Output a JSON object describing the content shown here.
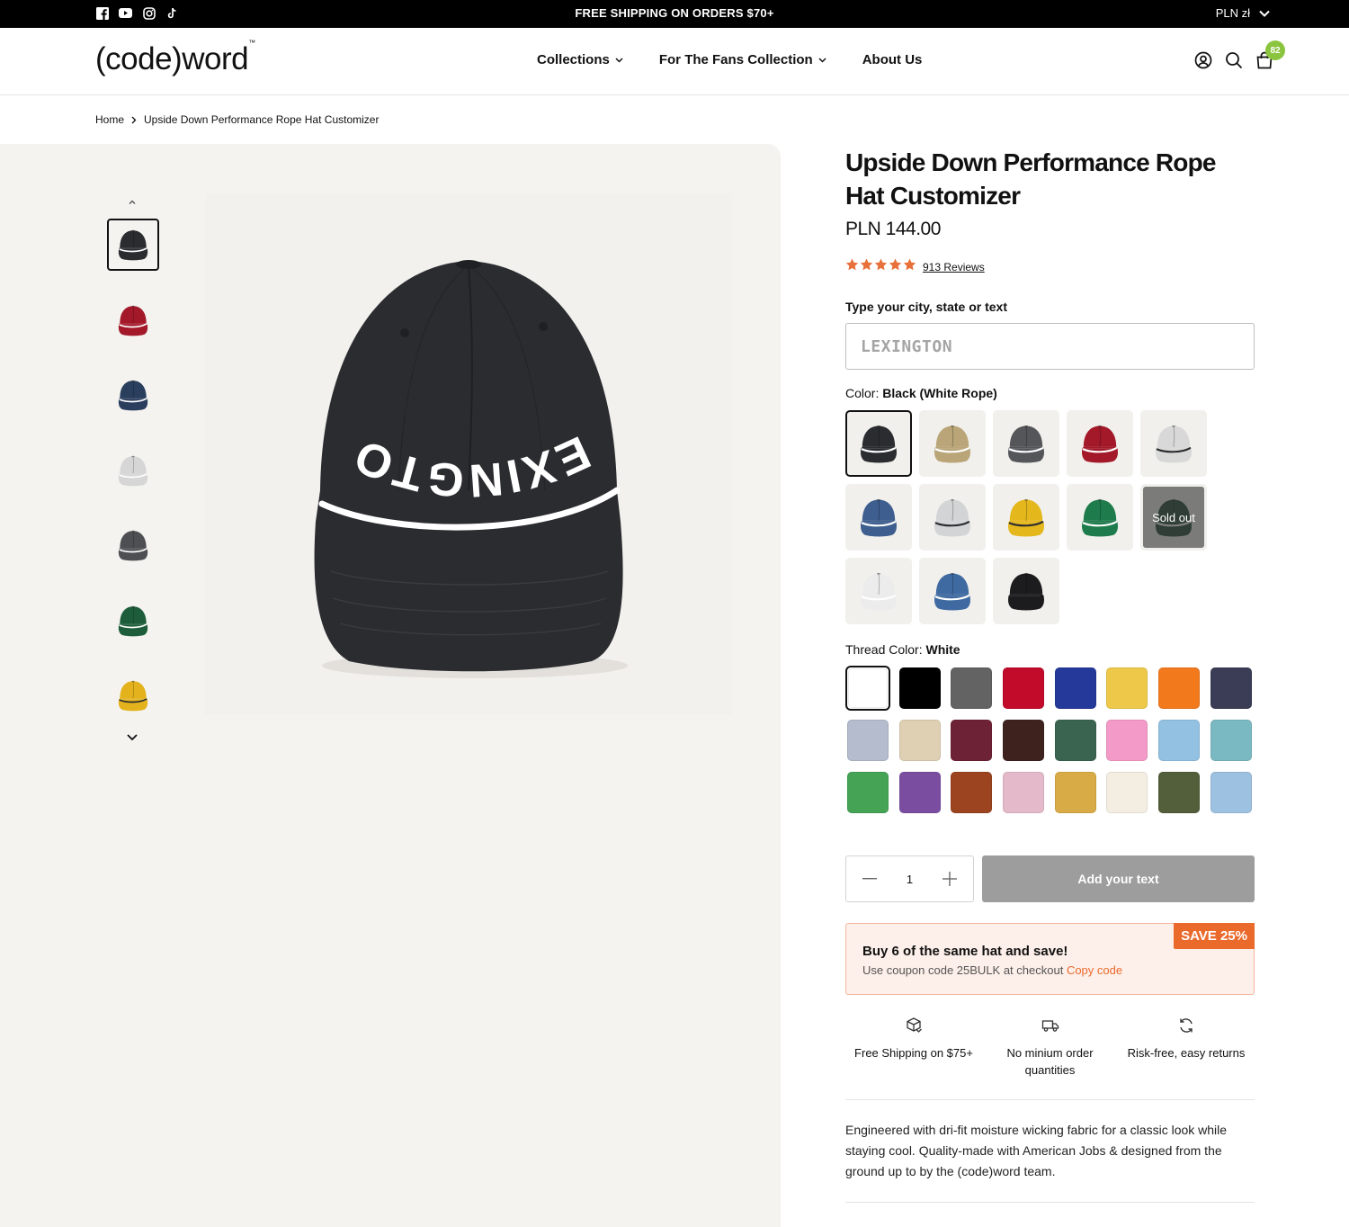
{
  "topbar": {
    "announcement": "FREE SHIPPING ON ORDERS $70+",
    "currency": "PLN zł",
    "socials": [
      "facebook-icon",
      "youtube-icon",
      "instagram-icon",
      "tiktok-icon"
    ]
  },
  "header": {
    "logo": "(code)word",
    "logo_tm": "™",
    "nav": [
      {
        "label": "Collections",
        "has_dropdown": true
      },
      {
        "label": "For The Fans Collection",
        "has_dropdown": true
      },
      {
        "label": "About Us",
        "has_dropdown": false
      }
    ],
    "cart_count": "82"
  },
  "breadcrumb": {
    "home": "Home",
    "current": "Upside Down Performance Rope Hat Customizer"
  },
  "gallery": {
    "main_image_text": "LEXINGTON",
    "thumbnails": [
      {
        "color": "#2b2c30",
        "rope": "#ffffff"
      },
      {
        "color": "#a3192a",
        "rope": "#ffffff"
      },
      {
        "color": "#2a3e5e",
        "rope": "#ffffff"
      },
      {
        "color": "#d6d6d6",
        "rope": "#ffffff"
      },
      {
        "color": "#4e4f53",
        "rope": "#ffffff"
      },
      {
        "color": "#1e5d3b",
        "rope": "#ffffff"
      },
      {
        "color": "#e3b21c",
        "rope": "#2b2c30"
      }
    ]
  },
  "product": {
    "title": "Upside Down Performance Rope Hat Customizer",
    "price": "PLN 144.00",
    "rating": 5,
    "reviews": "913 Reviews",
    "custom_label": "Type your city, state or text",
    "custom_placeholder": "LEXINGTON",
    "color_label": "Color:",
    "color_value": "Black (White Rope)",
    "hat_colors": [
      {
        "color": "#2b2c30",
        "rope": "#ffffff",
        "sold_out": false
      },
      {
        "color": "#b9a578",
        "rope": "#ffffff",
        "sold_out": false
      },
      {
        "color": "#55565a",
        "rope": "#ffffff",
        "sold_out": false
      },
      {
        "color": "#a3192a",
        "rope": "#ffffff",
        "sold_out": false
      },
      {
        "color": "#d8d8d8",
        "rope": "#2b2c30",
        "sold_out": false
      },
      {
        "color": "#3d5e8e",
        "rope": "#ffffff",
        "sold_out": false
      },
      {
        "color": "#d2d4d6",
        "rope": "#2b2c30",
        "sold_out": false
      },
      {
        "color": "#e4b71d",
        "rope": "#2b2c30",
        "sold_out": false
      },
      {
        "color": "#1e7b4c",
        "rope": "#ffffff",
        "sold_out": false
      },
      {
        "color": "#17412c",
        "rope": "#ffffff",
        "sold_out": true
      },
      {
        "color": "#ececec",
        "rope": "#ffffff",
        "sold_out": false
      },
      {
        "color": "#3f6aa1",
        "rope": "#ffffff",
        "sold_out": false
      },
      {
        "color": "#1c1c1e",
        "rope": "#1c1c1e",
        "sold_out": false
      }
    ],
    "sold_out_label": "Sold out",
    "thread_label": "Thread Color:",
    "thread_value": "White",
    "thread_colors": [
      "#ffffff",
      "#000000",
      "#636363",
      "#c20a2b",
      "#25399a",
      "#edc849",
      "#f27a1d",
      "#3a3d55",
      "#b4bccd",
      "#dfcfb3",
      "#6e2236",
      "#3e221e",
      "#3a6450",
      "#f39ac8",
      "#92c1e1",
      "#7bb9c2",
      "#44a355",
      "#7a4da0",
      "#9c4420",
      "#e4b9ca",
      "#d8ab46",
      "#f4eee2",
      "#535e3b",
      "#9dc1e1"
    ],
    "quantity": "1",
    "add_button": "Add your text",
    "promo": {
      "title": "Buy 6 of the same hat and save!",
      "text": "Use coupon code 25BULK at checkout",
      "copy": "Copy code",
      "badge": "SAVE 25%"
    },
    "features": [
      {
        "icon": "box-icon",
        "text": "Free Shipping on $75+"
      },
      {
        "icon": "truck-icon",
        "text": "No minium order quantities"
      },
      {
        "icon": "refresh-icon",
        "text": "Risk-free, easy returns"
      }
    ],
    "description": "Engineered with dri-fit moisture wicking fabric for a classic look while staying cool. Quality-made with American Jobs & designed from the ground up to by the (code)word team."
  },
  "colors": {
    "accent": "#ea6a2c",
    "badge_green": "#8bc53f",
    "star": "#e8703a",
    "gallery_bg": "#f4f3ef"
  }
}
